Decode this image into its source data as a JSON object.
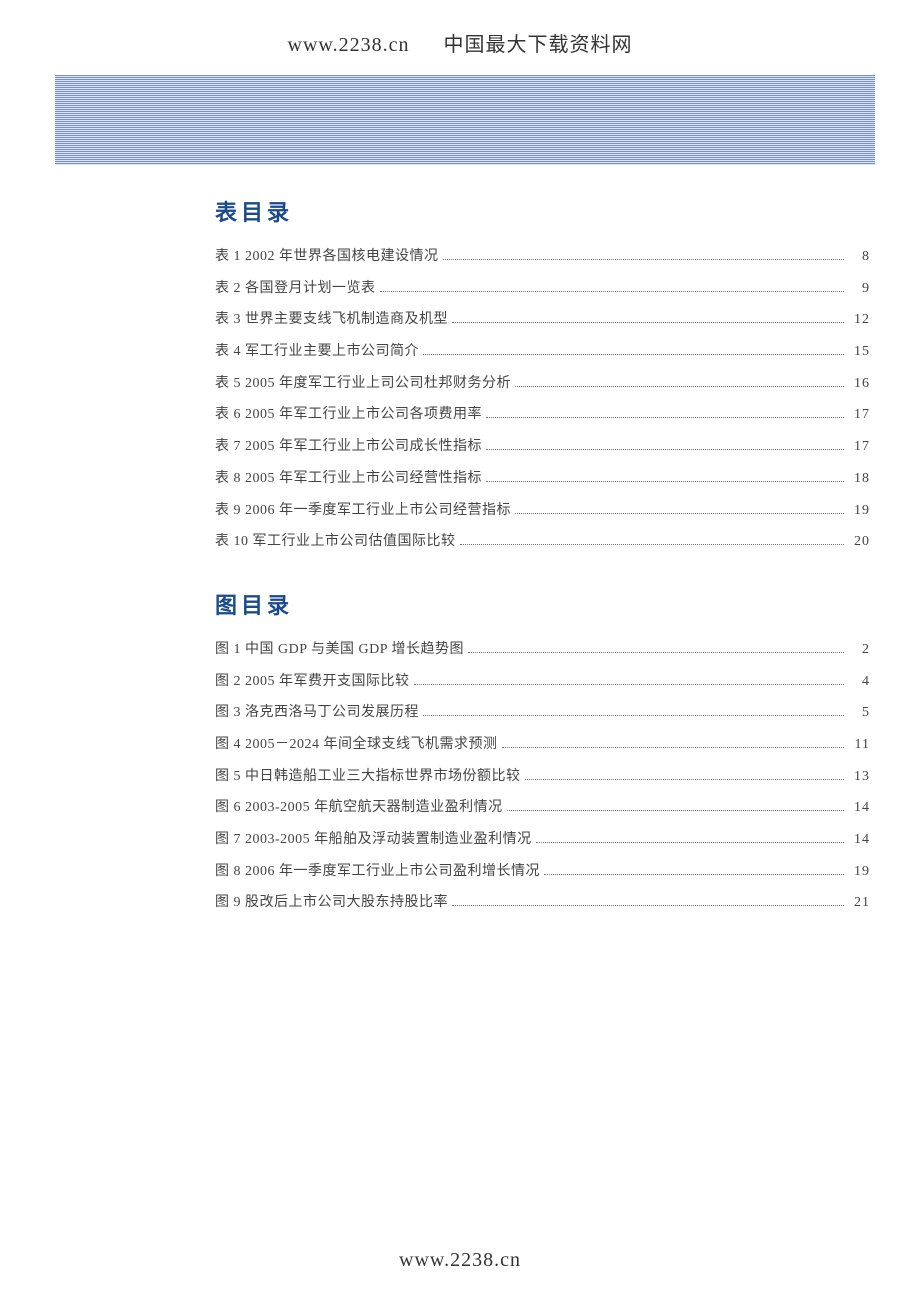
{
  "header": {
    "url": "www.2238.cn",
    "title": "中国最大下载资料网"
  },
  "sections": [
    {
      "heading": "表目录",
      "entries": [
        {
          "label": "表 1 2002 年世界各国核电建设情况",
          "page": "8"
        },
        {
          "label": "表 2 各国登月计划一览表",
          "page": "9"
        },
        {
          "label": "表 3 世界主要支线飞机制造商及机型",
          "page": "12"
        },
        {
          "label": "表 4 军工行业主要上市公司简介",
          "page": "15"
        },
        {
          "label": "表 5 2005 年度军工行业上司公司杜邦财务分析",
          "page": "16"
        },
        {
          "label": "表 6 2005 年军工行业上市公司各项费用率",
          "page": "17"
        },
        {
          "label": "表 7 2005 年军工行业上市公司成长性指标",
          "page": "17"
        },
        {
          "label": "表 8 2005 年军工行业上市公司经营性指标",
          "page": "18"
        },
        {
          "label": "表 9 2006 年一季度军工行业上市公司经营指标",
          "page": "19"
        },
        {
          "label": "表 10  军工行业上市公司估值国际比较",
          "page": "20"
        }
      ]
    },
    {
      "heading": "图目录",
      "entries": [
        {
          "label": "图 1 中国 GDP 与美国 GDP 增长趋势图",
          "page": "2"
        },
        {
          "label": "图 2 2005 年军费开支国际比较",
          "page": "4"
        },
        {
          "label": "图 3 洛克西洛马丁公司发展历程",
          "page": "5"
        },
        {
          "label": "图 4 2005－2024 年间全球支线飞机需求预测",
          "page": "11"
        },
        {
          "label": "图 5 中日韩造船工业三大指标世界市场份额比较",
          "page": "13"
        },
        {
          "label": "图 6 2003-2005 年航空航天器制造业盈利情况",
          "page": "14"
        },
        {
          "label": "图 7 2003-2005 年船舶及浮动装置制造业盈利情况",
          "page": "14"
        },
        {
          "label": "图 8 2006 年一季度军工行业上市公司盈利增长情况",
          "page": "19"
        },
        {
          "label": "图 9 股改后上市公司大股东持股比率",
          "page": "21"
        }
      ]
    }
  ],
  "footer": {
    "url": "www.2238.cn"
  }
}
